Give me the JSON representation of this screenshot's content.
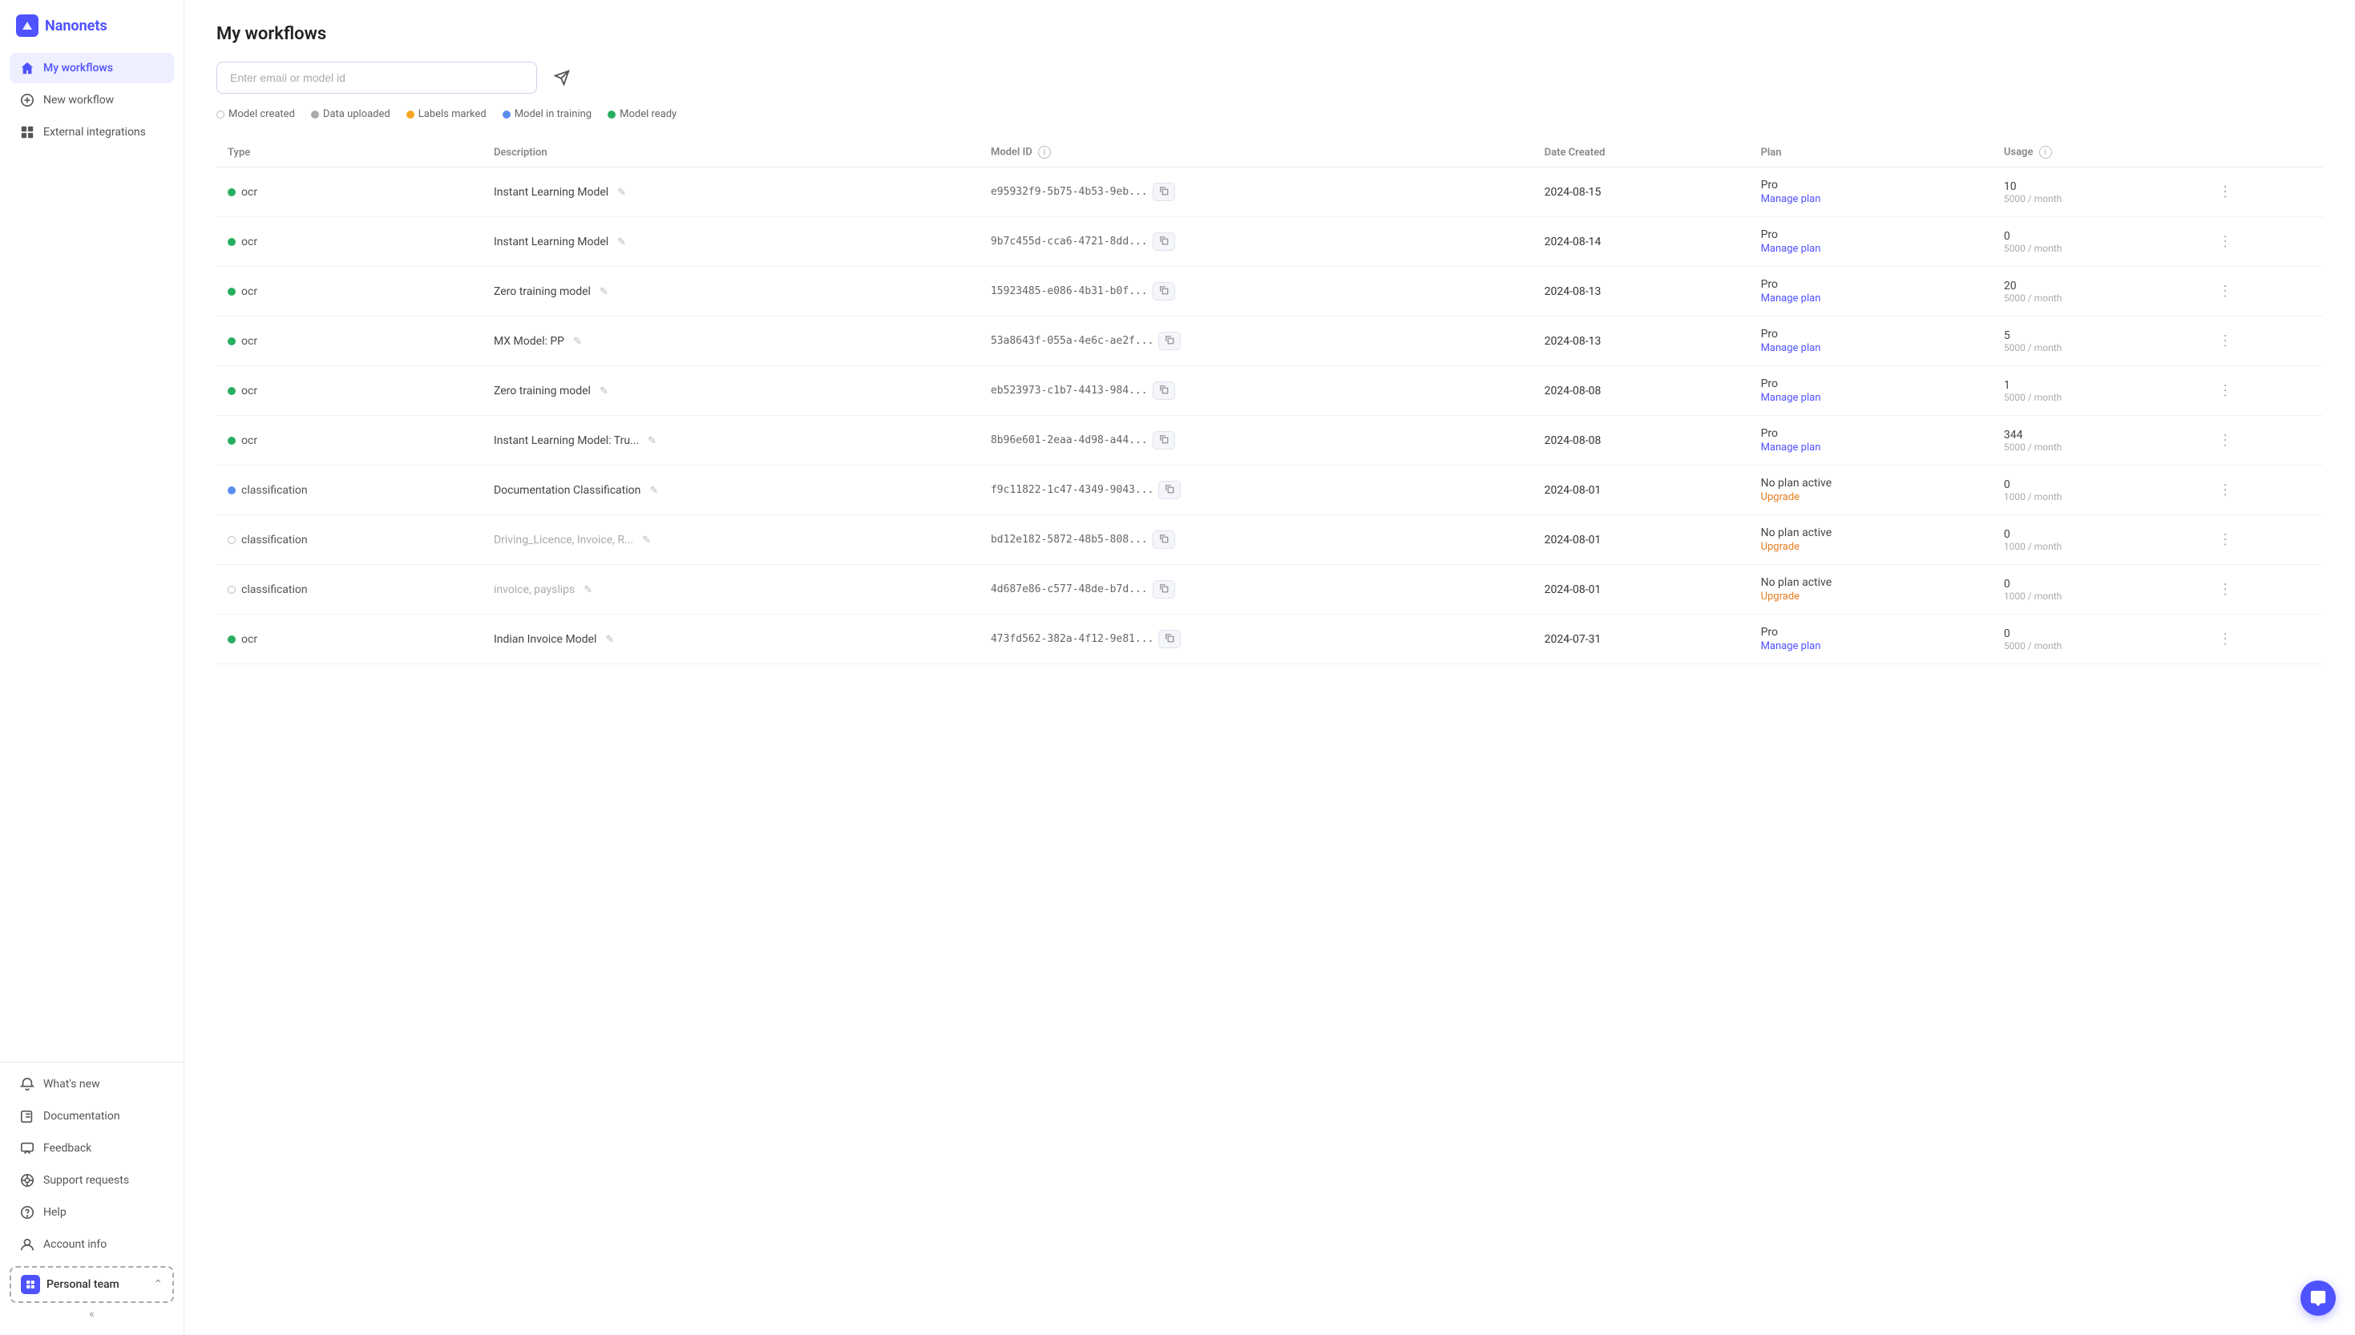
{
  "app": {
    "name": "Nanonets"
  },
  "sidebar": {
    "nav": [
      {
        "id": "my-workflows",
        "label": "My workflows",
        "active": true
      },
      {
        "id": "new-workflow",
        "label": "New workflow",
        "active": false
      },
      {
        "id": "external-integrations",
        "label": "External integrations",
        "active": false
      }
    ],
    "bottom": [
      {
        "id": "whats-new",
        "label": "What's new"
      },
      {
        "id": "documentation",
        "label": "Documentation"
      },
      {
        "id": "feedback",
        "label": "Feedback"
      },
      {
        "id": "support-requests",
        "label": "Support requests"
      },
      {
        "id": "help",
        "label": "Help"
      },
      {
        "id": "account-info",
        "label": "Account info"
      }
    ],
    "team": {
      "label": "Personal team",
      "collapse_label": "«"
    }
  },
  "search": {
    "placeholder": "Enter email or model id"
  },
  "legend": [
    {
      "id": "model-created",
      "label": "Model created",
      "dot": "empty"
    },
    {
      "id": "data-uploaded",
      "label": "Data uploaded",
      "dot": "grey"
    },
    {
      "id": "labels-marked",
      "label": "Labels marked",
      "dot": "orange"
    },
    {
      "id": "model-in-training",
      "label": "Model in training",
      "dot": "blue"
    },
    {
      "id": "model-ready",
      "label": "Model ready",
      "dot": "green"
    }
  ],
  "table": {
    "headers": [
      "Type",
      "Description",
      "Model ID",
      "Date Created",
      "Plan",
      "Usage"
    ],
    "rows": [
      {
        "type": "ocr",
        "status": "green",
        "description": "Instant Learning Model",
        "desc_muted": false,
        "model_id": "e95932f9-5b75-4b53-9eb...",
        "date": "2024-08-15",
        "plan": "Pro",
        "plan_action": "Manage plan",
        "plan_upgrade": false,
        "usage": "10",
        "usage_limit": "5000 / month"
      },
      {
        "type": "ocr",
        "status": "green",
        "description": "Instant Learning Model",
        "desc_muted": false,
        "model_id": "9b7c455d-cca6-4721-8dd...",
        "date": "2024-08-14",
        "plan": "Pro",
        "plan_action": "Manage plan",
        "plan_upgrade": false,
        "usage": "0",
        "usage_limit": "5000 / month"
      },
      {
        "type": "ocr",
        "status": "green",
        "description": "Zero training model",
        "desc_muted": false,
        "model_id": "15923485-e086-4b31-b0f...",
        "date": "2024-08-13",
        "plan": "Pro",
        "plan_action": "Manage plan",
        "plan_upgrade": false,
        "usage": "20",
        "usage_limit": "5000 / month"
      },
      {
        "type": "ocr",
        "status": "green",
        "description": "MX Model: PP",
        "desc_muted": false,
        "model_id": "53a8643f-055a-4e6c-ae2f...",
        "date": "2024-08-13",
        "plan": "Pro",
        "plan_action": "Manage plan",
        "plan_upgrade": false,
        "usage": "5",
        "usage_limit": "5000 / month"
      },
      {
        "type": "ocr",
        "status": "green",
        "description": "Zero training model",
        "desc_muted": false,
        "model_id": "eb523973-c1b7-4413-984...",
        "date": "2024-08-08",
        "plan": "Pro",
        "plan_action": "Manage plan",
        "plan_upgrade": false,
        "usage": "1",
        "usage_limit": "5000 / month"
      },
      {
        "type": "ocr",
        "status": "green",
        "description": "Instant Learning Model: Tru...",
        "desc_muted": false,
        "model_id": "8b96e601-2eaa-4d98-a44...",
        "date": "2024-08-08",
        "plan": "Pro",
        "plan_action": "Manage plan",
        "plan_upgrade": false,
        "usage": "344",
        "usage_limit": "5000 / month"
      },
      {
        "type": "classification",
        "status": "blue",
        "description": "Documentation Classification",
        "desc_muted": false,
        "model_id": "f9c11822-1c47-4349-9043...",
        "date": "2024-08-01",
        "plan": "No plan active",
        "plan_action": "Upgrade",
        "plan_upgrade": true,
        "usage": "0",
        "usage_limit": "1000 / month"
      },
      {
        "type": "classification",
        "status": "empty",
        "description": "Driving_Licence, Invoice, R...",
        "desc_muted": true,
        "model_id": "bd12e182-5872-48b5-808...",
        "date": "2024-08-01",
        "plan": "No plan active",
        "plan_action": "Upgrade",
        "plan_upgrade": true,
        "usage": "0",
        "usage_limit": "1000 / month"
      },
      {
        "type": "classification",
        "status": "empty",
        "description": "invoice, payslips",
        "desc_muted": true,
        "model_id": "4d687e86-c577-48de-b7d...",
        "date": "2024-08-01",
        "plan": "No plan active",
        "plan_action": "Upgrade",
        "plan_upgrade": true,
        "usage": "0",
        "usage_limit": "1000 / month"
      },
      {
        "type": "ocr",
        "status": "green",
        "description": "Indian Invoice Model",
        "desc_muted": false,
        "model_id": "473fd562-382a-4f12-9e81...",
        "date": "2024-07-31",
        "plan": "Pro",
        "plan_action": "Manage plan",
        "plan_upgrade": false,
        "usage": "0",
        "usage_limit": "5000 / month"
      }
    ]
  },
  "colors": {
    "accent": "#4f52ff",
    "green": "#27ae60",
    "blue": "#5b8def",
    "orange": "#f5a623",
    "upgrade": "#e67e22"
  }
}
